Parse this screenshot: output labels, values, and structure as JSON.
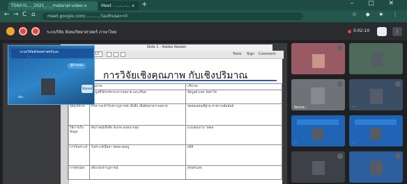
{
  "browser": {
    "tabs": [
      {
        "label": "T560-YL..._2021_..._material-video-x"
      },
      {
        "label": "Meet - ...-...-... x"
      }
    ],
    "new_tab_symbol": "+",
    "window_controls": "– ▢ ✕",
    "nav": {
      "back": "←",
      "forward": "→",
      "reload": "C",
      "home": "⌂"
    },
    "url": "meet.google.com/...-...-...?authuser=0",
    "extension_icons": "☆ ◆ ★ ⋮"
  },
  "meet": {
    "title": "ระบบวิจัย สังคมวิทยาศาสตร์ ภาษาไทย",
    "recording_time": "5:02:10",
    "layout_button": "⋮",
    "colors": {
      "accent": "#e8453c",
      "chrome": "#1e4c43",
      "dark": "#2a2b2e",
      "slide_rule": "#2e5fa0"
    }
  },
  "pdf_viewer": {
    "window_title": "Slide 1 - Adobe Reader",
    "toolbar_right": [
      "Tools",
      "Sign",
      "Comment"
    ],
    "page_box": "1 / 12"
  },
  "slide": {
    "title": "การวิจัยเชิงคุณภาพ กับเชิงปริมาณ",
    "table": [
      [
        "",
        "คุณภาพ",
        "ปริมาณ"
      ],
      [
        "",
        "ข้อมูลที่ได้บรรยาย ความหมาย และบริบท",
        "ข้อมูลตัวเลข วัดค่าได้"
      ],
      [
        "จุดมุ่งหมาย",
        "ทำความเข้าใจปรากฏการณ์ เชิงลึก เพื่อค้นหาความหมาย",
        "ทดสอบสมมติฐาน หาความสัมพันธ์"
      ],
      [
        "วิธีการเก็บข้อมูล",
        "สัมภาษณ์เชิงลึก สังเกต สนทนากลุ่ม",
        "แบบสอบถาม วัดผล"
      ],
      [
        "การวิเคราะห์",
        "วิเคราะห์เนื้อหา จัดหมวดหมู่",
        "สถิติ"
      ],
      [
        "การสรุปผล",
        "อธิบายปรากฏการณ์",
        "สรุปตัวเลข"
      ]
    ]
  },
  "self_view": {
    "banner_line1": "ระบบวิจัยสังคมศาสตร์และ",
    "banner_line2": "...",
    "tag": "ผู้นำเสนอ",
    "name": "ห้อง",
    "chip": "Shared"
  },
  "participants": [
    {
      "name": ""
    },
    {
      "name": ""
    },
    {
      "name": "จิตรเกต..."
    },
    {
      "name": "...."
    },
    {
      "name": "..."
    },
    {
      "name": "..."
    },
    {
      "name": ""
    },
    {
      "name": ""
    }
  ]
}
